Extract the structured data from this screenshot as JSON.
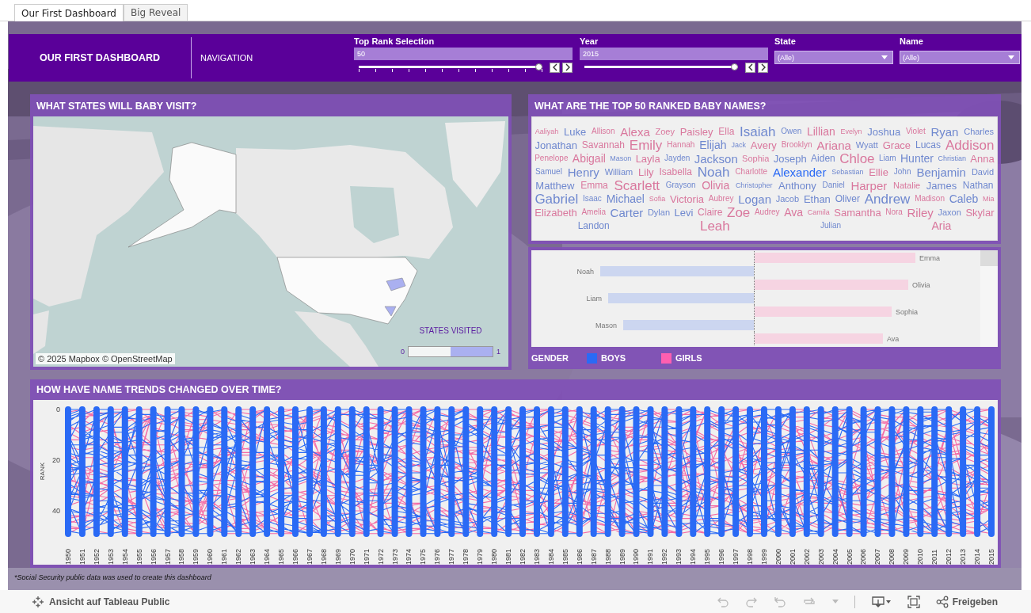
{
  "tabs": [
    {
      "label": "Our First Dashboard",
      "selected": true
    },
    {
      "label": "Big Reveal",
      "selected": false
    }
  ],
  "header": {
    "title": "OUR FIRST DASHBOARD",
    "navigation": "NAVIGATION",
    "sliders": [
      {
        "label": "Top Rank Selection",
        "value": "50",
        "level": 1
      },
      {
        "label": "Year",
        "value": "2015",
        "level": 1
      }
    ],
    "dropdowns": [
      {
        "label": "State",
        "value": "(Alle)"
      },
      {
        "label": "Name",
        "value": "(Alle)"
      }
    ]
  },
  "map_panel": {
    "title": "WHAT STATES WILL BABY VISIT?",
    "attribution": "© 2025 Mapbox © OpenStreetMap",
    "legend": {
      "title": "STATES VISITED",
      "min": "0",
      "max": "1"
    }
  },
  "word_cloud": {
    "title": "WHAT ARE THE TOP 50 RANKED BABY NAMES?",
    "words": [
      {
        "text": "Aaliyah",
        "kind": "girl",
        "selected": false
      },
      {
        "text": "Luke",
        "kind": "boy",
        "selected": false
      },
      {
        "text": "Allison",
        "kind": "girl",
        "selected": false
      },
      {
        "text": "Alexa",
        "kind": "girl",
        "selected": false
      },
      {
        "text": "Zoey",
        "kind": "girl",
        "selected": false
      },
      {
        "text": "Paisley",
        "kind": "girl",
        "selected": false
      },
      {
        "text": "Ella",
        "kind": "girl",
        "selected": false
      },
      {
        "text": "Isaiah",
        "kind": "boy",
        "selected": false
      },
      {
        "text": "Owen",
        "kind": "boy",
        "selected": false
      },
      {
        "text": "Lillian",
        "kind": "girl",
        "selected": false
      },
      {
        "text": "Evelyn",
        "kind": "girl",
        "selected": false
      },
      {
        "text": "Joshua",
        "kind": "boy",
        "selected": false
      },
      {
        "text": "Violet",
        "kind": "girl",
        "selected": false
      },
      {
        "text": "Ryan",
        "kind": "boy",
        "selected": false
      },
      {
        "text": "Charles",
        "kind": "boy",
        "selected": false
      },
      {
        "text": "Jonathan",
        "kind": "boy",
        "selected": false
      },
      {
        "text": "Savannah",
        "kind": "girl",
        "selected": false
      },
      {
        "text": "Emily",
        "kind": "girl",
        "selected": false
      },
      {
        "text": "Hannah",
        "kind": "girl",
        "selected": false
      },
      {
        "text": "Elijah",
        "kind": "boy",
        "selected": false
      },
      {
        "text": "Jack",
        "kind": "boy",
        "selected": false
      },
      {
        "text": "Avery",
        "kind": "girl",
        "selected": false
      },
      {
        "text": "Brooklyn",
        "kind": "girl",
        "selected": false
      },
      {
        "text": "Ariana",
        "kind": "girl",
        "selected": false
      },
      {
        "text": "Wyatt",
        "kind": "boy",
        "selected": false
      },
      {
        "text": "Grace",
        "kind": "girl",
        "selected": false
      },
      {
        "text": "Lucas",
        "kind": "boy",
        "selected": false
      },
      {
        "text": "Addison",
        "kind": "girl",
        "selected": false
      },
      {
        "text": "Penelope",
        "kind": "girl",
        "selected": false
      },
      {
        "text": "Abigail",
        "kind": "girl",
        "selected": false
      },
      {
        "text": "Mason",
        "kind": "boy",
        "selected": false
      },
      {
        "text": "Layla",
        "kind": "girl",
        "selected": false
      },
      {
        "text": "Jayden",
        "kind": "boy",
        "selected": false
      },
      {
        "text": "Jackson",
        "kind": "boy",
        "selected": false
      },
      {
        "text": "Sophia",
        "kind": "girl",
        "selected": false
      },
      {
        "text": "Joseph",
        "kind": "boy",
        "selected": false
      },
      {
        "text": "Aiden",
        "kind": "boy",
        "selected": false
      },
      {
        "text": "Chloe",
        "kind": "girl",
        "selected": false
      },
      {
        "text": "Liam",
        "kind": "boy",
        "selected": false
      },
      {
        "text": "Hunter",
        "kind": "boy",
        "selected": false
      },
      {
        "text": "Christian",
        "kind": "boy",
        "selected": false
      },
      {
        "text": "Anna",
        "kind": "girl",
        "selected": false
      },
      {
        "text": "Samuel",
        "kind": "boy",
        "selected": false
      },
      {
        "text": "Henry",
        "kind": "boy",
        "selected": false
      },
      {
        "text": "William",
        "kind": "boy",
        "selected": false
      },
      {
        "text": "Lily",
        "kind": "girl",
        "selected": false
      },
      {
        "text": "Isabella",
        "kind": "girl",
        "selected": false
      },
      {
        "text": "Noah",
        "kind": "boy",
        "selected": false
      },
      {
        "text": "Charlotte",
        "kind": "girl",
        "selected": false
      },
      {
        "text": "Alexander",
        "kind": "boy",
        "selected": true
      },
      {
        "text": "Sebastian",
        "kind": "boy",
        "selected": false
      },
      {
        "text": "Ellie",
        "kind": "girl",
        "selected": false
      },
      {
        "text": "John",
        "kind": "boy",
        "selected": false
      },
      {
        "text": "Benjamin",
        "kind": "boy",
        "selected": false
      },
      {
        "text": "David",
        "kind": "boy",
        "selected": false
      },
      {
        "text": "Matthew",
        "kind": "boy",
        "selected": false
      },
      {
        "text": "Emma",
        "kind": "girl",
        "selected": false
      },
      {
        "text": "Scarlett",
        "kind": "girl",
        "selected": false
      },
      {
        "text": "Grayson",
        "kind": "boy",
        "selected": false
      },
      {
        "text": "Olivia",
        "kind": "girl",
        "selected": false
      },
      {
        "text": "Christopher",
        "kind": "boy",
        "selected": false
      },
      {
        "text": "Anthony",
        "kind": "boy",
        "selected": false
      },
      {
        "text": "Daniel",
        "kind": "boy",
        "selected": false
      },
      {
        "text": "Harper",
        "kind": "girl",
        "selected": false
      },
      {
        "text": "Natalie",
        "kind": "girl",
        "selected": false
      },
      {
        "text": "James",
        "kind": "boy",
        "selected": false
      },
      {
        "text": "Nathan",
        "kind": "boy",
        "selected": false
      },
      {
        "text": "Gabriel",
        "kind": "boy",
        "selected": false
      },
      {
        "text": "Isaac",
        "kind": "boy",
        "selected": false
      },
      {
        "text": "Michael",
        "kind": "boy",
        "selected": false
      },
      {
        "text": "Sofia",
        "kind": "girl",
        "selected": false
      },
      {
        "text": "Victoria",
        "kind": "girl",
        "selected": false
      },
      {
        "text": "Aubrey",
        "kind": "girl",
        "selected": false
      },
      {
        "text": "Logan",
        "kind": "boy",
        "selected": false
      },
      {
        "text": "Jacob",
        "kind": "boy",
        "selected": false
      },
      {
        "text": "Ethan",
        "kind": "boy",
        "selected": false
      },
      {
        "text": "Oliver",
        "kind": "boy",
        "selected": false
      },
      {
        "text": "Andrew",
        "kind": "boy",
        "selected": false
      },
      {
        "text": "Madison",
        "kind": "girl",
        "selected": false
      },
      {
        "text": "Caleb",
        "kind": "boy",
        "selected": false
      },
      {
        "text": "Mia",
        "kind": "girl",
        "selected": false
      },
      {
        "text": "Elizabeth",
        "kind": "girl",
        "selected": false
      },
      {
        "text": "Amelia",
        "kind": "girl",
        "selected": false
      },
      {
        "text": "Carter",
        "kind": "boy",
        "selected": false
      },
      {
        "text": "Dylan",
        "kind": "boy",
        "selected": false
      },
      {
        "text": "Levi",
        "kind": "boy",
        "selected": false
      },
      {
        "text": "Claire",
        "kind": "girl",
        "selected": false
      },
      {
        "text": "Zoe",
        "kind": "girl",
        "selected": false
      },
      {
        "text": "Audrey",
        "kind": "girl",
        "selected": false
      },
      {
        "text": "Ava",
        "kind": "girl",
        "selected": false
      },
      {
        "text": "Camila",
        "kind": "girl",
        "selected": false
      },
      {
        "text": "Samantha",
        "kind": "girl",
        "selected": false
      },
      {
        "text": "Nora",
        "kind": "girl",
        "selected": false
      },
      {
        "text": "Riley",
        "kind": "girl",
        "selected": false
      },
      {
        "text": "Jaxon",
        "kind": "boy",
        "selected": false
      },
      {
        "text": "Skylar",
        "kind": "girl",
        "selected": false
      },
      {
        "text": "Landon",
        "kind": "boy",
        "selected": false
      },
      {
        "text": "Leah",
        "kind": "girl",
        "selected": false
      },
      {
        "text": "Julian",
        "kind": "boy",
        "selected": false
      },
      {
        "text": "Aria",
        "kind": "girl",
        "selected": false
      }
    ]
  },
  "bar_chart": {
    "bars": [
      {
        "name": "Emma",
        "kind": "girl",
        "level": 0.75
      },
      {
        "name": "Noah",
        "kind": "boy",
        "level": 0.72
      },
      {
        "name": "Olivia",
        "kind": "girl",
        "level": 0.72
      },
      {
        "name": "Liam",
        "kind": "boy",
        "level": 0.68
      },
      {
        "name": "Sophia",
        "kind": "girl",
        "level": 0.64
      },
      {
        "name": "Mason",
        "kind": "boy",
        "level": 0.61
      },
      {
        "name": "Ava",
        "kind": "girl",
        "level": 0.6
      }
    ]
  },
  "gender_legend": {
    "title": "GENDER",
    "items": [
      {
        "label": "BOYS",
        "color": "#2a6af5"
      },
      {
        "label": "GIRLS",
        "color": "#ff5fb0"
      }
    ]
  },
  "trend_panel": {
    "title": "HOW HAVE NAME TRENDS CHANGED OVER TIME?",
    "y_title": "RANK",
    "y_ticks": [
      "0",
      "20",
      "40"
    ],
    "years": [
      "1950",
      "1951",
      "1952",
      "1953",
      "1954",
      "1955",
      "1956",
      "1957",
      "1958",
      "1959",
      "1960",
      "1961",
      "1962",
      "1963",
      "1964",
      "1965",
      "1966",
      "1967",
      "1968",
      "1969",
      "1970",
      "1971",
      "1972",
      "1973",
      "1974",
      "1975",
      "1976",
      "1977",
      "1978",
      "1979",
      "1980",
      "1981",
      "1982",
      "1983",
      "1984",
      "1985",
      "1986",
      "1987",
      "1988",
      "1989",
      "1990",
      "1991",
      "1992",
      "1993",
      "1994",
      "1995",
      "1996",
      "1997",
      "1998",
      "1999",
      "2000",
      "2001",
      "2002",
      "2003",
      "2004",
      "2005",
      "2006",
      "2007",
      "2008",
      "2009",
      "2010",
      "2011",
      "2012",
      "2013",
      "2014",
      "2015"
    ]
  },
  "footnote": "*Social Security public data was used to create this dashboard",
  "toolbar": {
    "view_link": "Ansicht auf Tableau Public",
    "share": "Freigeben"
  }
}
